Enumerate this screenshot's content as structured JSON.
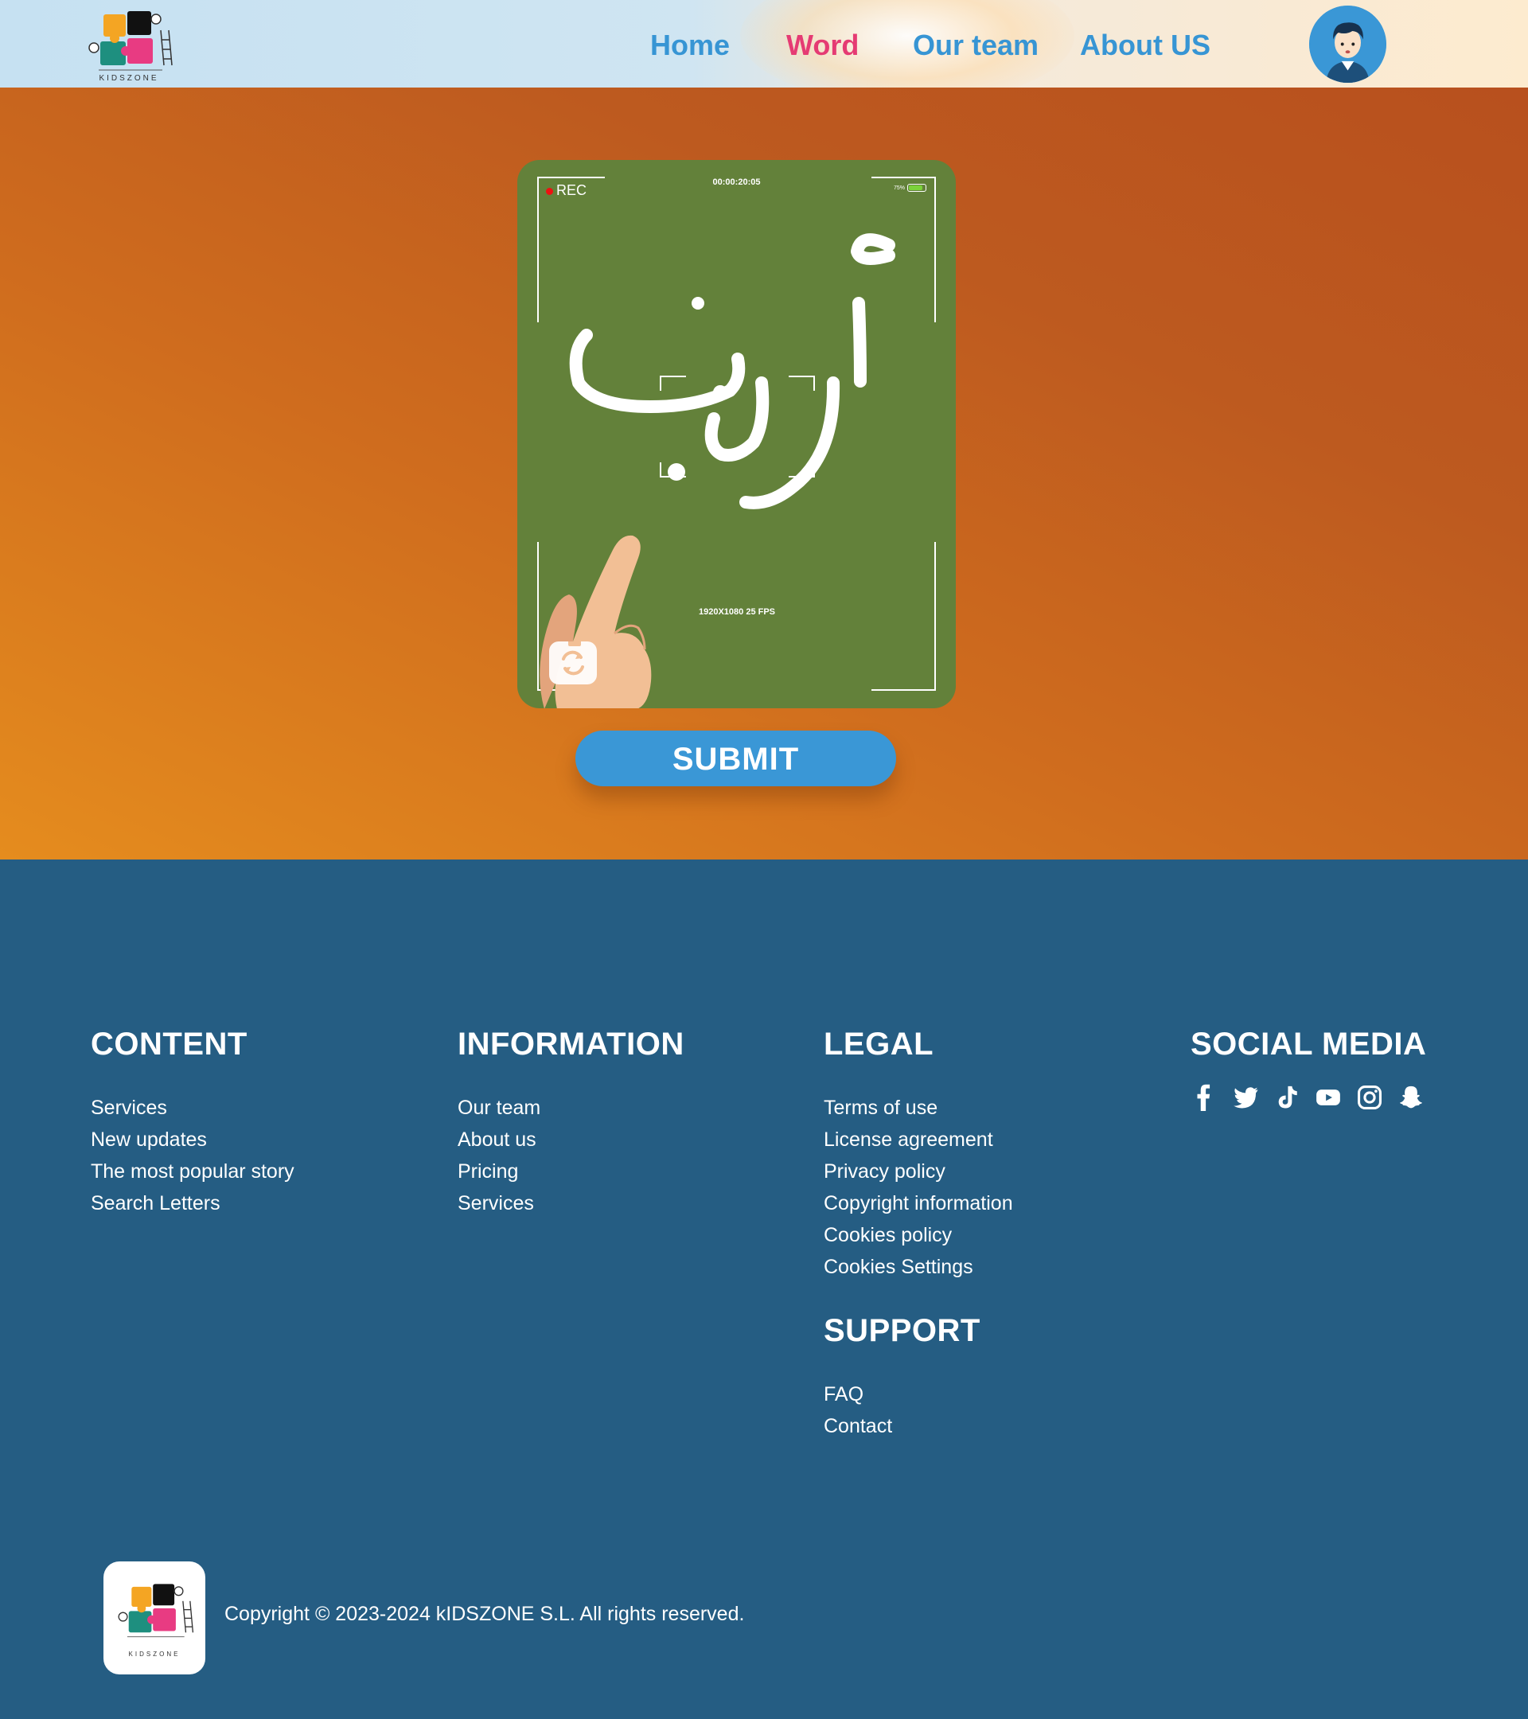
{
  "nav": {
    "logo_text": "KIDSZONE",
    "links": [
      {
        "label": "Home",
        "active": false
      },
      {
        "label": "Word",
        "active": true
      },
      {
        "label": "Our team",
        "active": false
      },
      {
        "label": "About US",
        "active": false
      }
    ]
  },
  "camera": {
    "rec_label": "REC",
    "timer": "00:00:20:05",
    "battery_label": "75%",
    "resolution": "1920X1080 25 FPS",
    "written_word": "أرنب"
  },
  "submit_label": "SUBMIT",
  "footer": {
    "content": {
      "heading": "CONTENT",
      "links": [
        "Services",
        "New updates",
        "The most popular story",
        "Search Letters"
      ]
    },
    "information": {
      "heading": "INFORMATION",
      "links": [
        "Our team",
        "About us",
        "Pricing",
        "Services"
      ]
    },
    "legal": {
      "heading": "LEGAL",
      "links": [
        "Terms of use",
        "License agreement",
        "Privacy policy",
        "Copyright information",
        "Cookies policy",
        "Cookies Settings"
      ]
    },
    "support": {
      "heading": "SUPPORT",
      "links": [
        "FAQ",
        "Contact"
      ]
    },
    "social": {
      "heading": "SOCIAL MEDIA",
      "icons": [
        "facebook-icon",
        "twitter-icon",
        "tiktok-icon",
        "youtube-icon",
        "instagram-icon",
        "snapchat-icon"
      ]
    },
    "copyright": "Copyright © 2023-2024 kIDSZONE S.L. All rights reserved."
  },
  "colors": {
    "accent_blue": "#3a97d6",
    "active_pink": "#e53b73",
    "footer_bg": "#255d83",
    "board_green": "#63813a"
  }
}
